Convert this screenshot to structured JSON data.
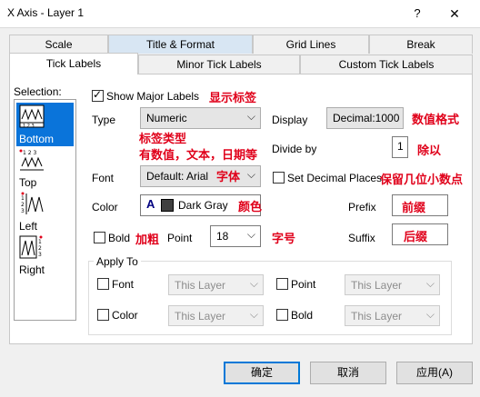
{
  "window": {
    "title": "X Axis - Layer 1",
    "help": "?",
    "close": "✕"
  },
  "tabs_row1": [
    "Scale",
    "Title & Format",
    "Grid Lines",
    "Break"
  ],
  "tabs_row2": [
    "Tick Labels",
    "Minor Tick Labels",
    "Custom Tick Labels"
  ],
  "selection": {
    "label": "Selection:",
    "items": [
      "Bottom",
      "Top",
      "Left",
      "Right"
    ],
    "selected": "Bottom"
  },
  "show_major": {
    "label": "Show Major Labels",
    "checked": true,
    "note": "显示标签"
  },
  "type": {
    "label": "Type",
    "value": "Numeric",
    "note_line1": "标签类型",
    "note_line2": "有数值，文本，日期等"
  },
  "display": {
    "label": "Display",
    "value": "Decimal:1000",
    "note": "数值格式"
  },
  "divide_by": {
    "label": "Divide by",
    "value": "1",
    "note": "除以"
  },
  "font": {
    "label": "Font",
    "value": "Default: Arial",
    "note": "字体"
  },
  "set_decimal": {
    "label": "Set Decimal Places",
    "checked": false,
    "note": "保留几位小数点"
  },
  "color": {
    "label": "Color",
    "glyph": "A",
    "swatch": "#404040",
    "value": "Dark Gray",
    "note": "颜色"
  },
  "prefix": {
    "label": "Prefix",
    "value": "前缀"
  },
  "suffix": {
    "label": "Suffix",
    "value": "后缀"
  },
  "bold": {
    "label": "Bold",
    "checked": false,
    "note": "加粗"
  },
  "point": {
    "label": "Point",
    "value": "18",
    "note": "字号"
  },
  "apply_to": {
    "title": "Apply To",
    "font_label": "Font",
    "font_value": "This Layer",
    "point_label": "Point",
    "point_value": "This Layer",
    "color_label": "Color",
    "color_value": "This Layer",
    "bold_label": "Bold",
    "bold_value": "This Layer"
  },
  "buttons": {
    "ok": "确定",
    "cancel": "取消",
    "apply": "应用(A)"
  },
  "colors": {
    "accent": "#0a74da",
    "note_red": "#e0001a",
    "tab_highlight": "#d8e6f3"
  }
}
